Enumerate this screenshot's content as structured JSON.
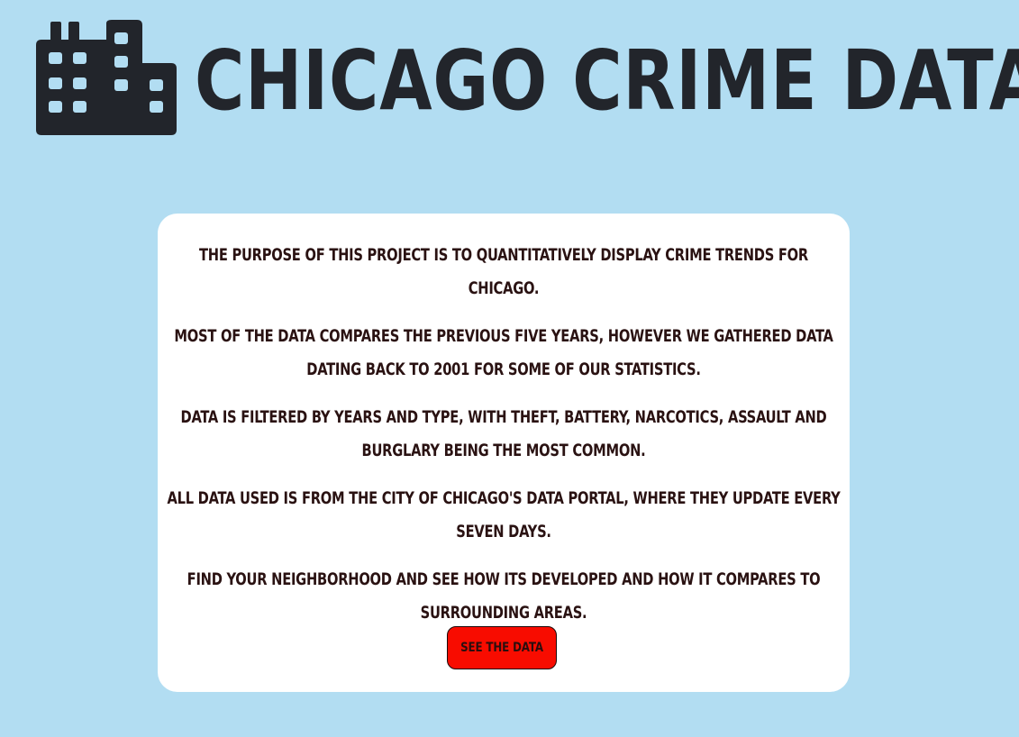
{
  "header": {
    "title": "CHICAGO CRIME DATA",
    "logo_icon": "building-icon",
    "title_color": "#22252b"
  },
  "colors": {
    "background": "#b2ddf2",
    "card": "#ffffff",
    "button": "#f80c00",
    "text": "#2a1212"
  },
  "intro": {
    "paragraphs": [
      "The purpose of this project is to quantitatively display crime trends for Chicago.",
      "Most of the data compares the previous five years, however we gathered data dating back to 2001 for some of our statistics.",
      "Data is filtered by years and type, with theft, battery, narcotics, assault and burglary being the most common.",
      "All data used is from the City of Chicago's Data Portal, where they update every seven days.",
      "Find your neighborhood and see how its developed and how it compares to surrounding areas."
    ],
    "cta_label": "SEE THE DATA"
  }
}
